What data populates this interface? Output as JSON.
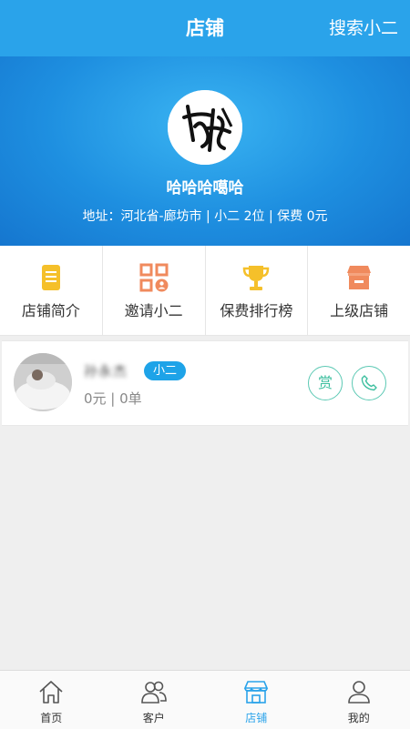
{
  "header": {
    "title": "店铺",
    "search_label": "搜索小二"
  },
  "shop": {
    "name": "哈哈哈噶哈",
    "meta": "地址：河北省-廊坊市 | 小二 2位 | 保费 0元",
    "avatar_icon": "calligraphy-signature-avatar"
  },
  "shortcuts": [
    {
      "label": "店铺简介",
      "icon": "document-icon",
      "color": "#f5c02a"
    },
    {
      "label": "邀请小二",
      "icon": "qrcode-icon",
      "color": "#f08a5d"
    },
    {
      "label": "保费排行榜",
      "icon": "trophy-icon",
      "color": "#f5c02a"
    },
    {
      "label": "上级店铺",
      "icon": "store-icon",
      "color": "#f08a5d"
    }
  ],
  "member": {
    "name": "孙永杰",
    "role": "小二",
    "stats": "0元 | 0单",
    "reward_label": "赏"
  },
  "tabbar": [
    {
      "label": "首页",
      "icon": "home-icon",
      "active": false
    },
    {
      "label": "客户",
      "icon": "users-icon",
      "active": false
    },
    {
      "label": "店铺",
      "icon": "store-icon",
      "active": true
    },
    {
      "label": "我的",
      "icon": "person-icon",
      "active": false
    }
  ],
  "colors": {
    "primary": "#2aa3ea",
    "teal": "#3dbf9f",
    "badge": "#1ea3e8"
  }
}
